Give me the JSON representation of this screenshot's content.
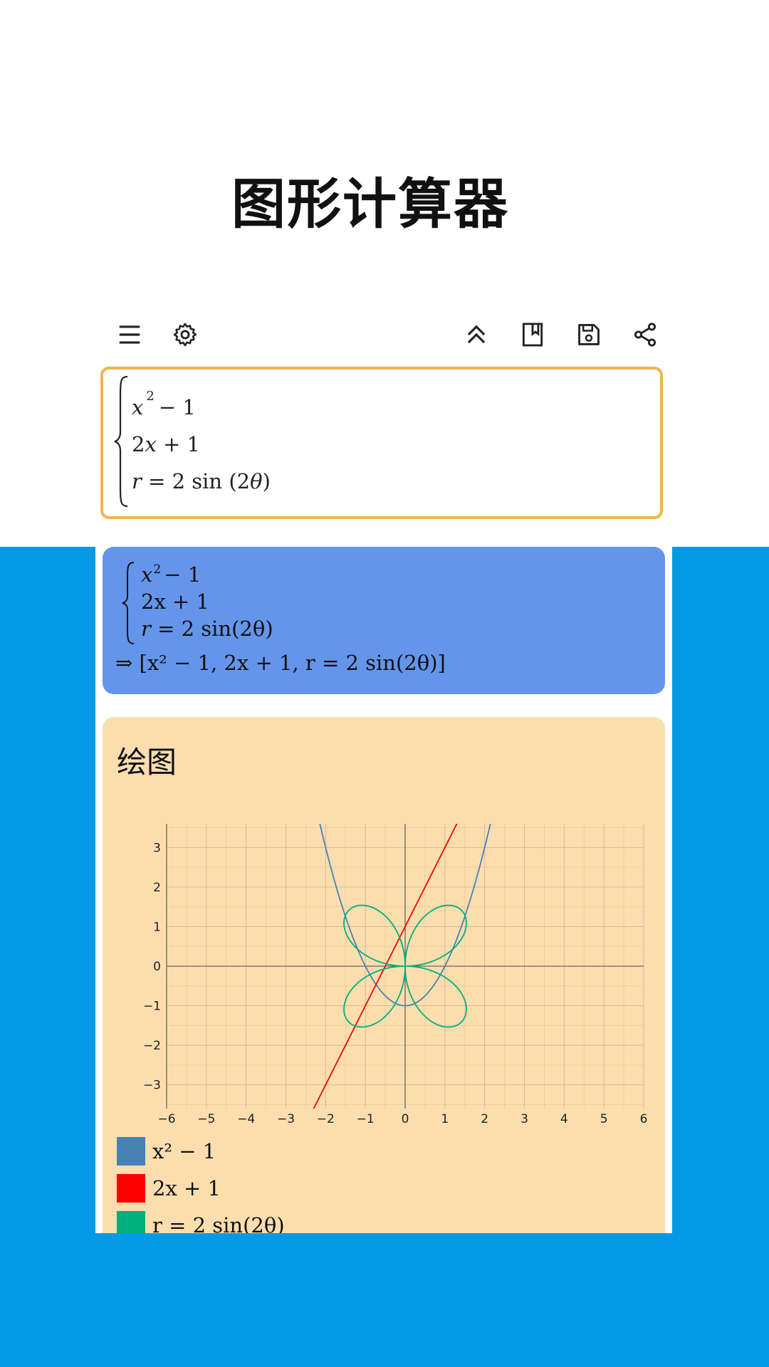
{
  "promo": {
    "title": "图形计算器"
  },
  "toolbar": {
    "icons": [
      "menu-icon",
      "gear-icon",
      "collapse-icon",
      "bookmark-icon",
      "save-icon",
      "share-icon"
    ]
  },
  "input": {
    "lines": [
      {
        "var": "x",
        "sup": "2",
        "rest": "− 1"
      },
      {
        "coef": "2",
        "var": "x",
        "rest": "+ 1"
      },
      {
        "lhs": "r",
        "rest": "= 2 sin (2",
        "theta": "θ",
        "close": ")"
      }
    ]
  },
  "result": {
    "line1_var": "x",
    "line1_sup": "2",
    "line1_rest": "− 1",
    "line2": "2x + 1",
    "line3_lhs": "r",
    "line3_rest": "= 2 sin(2θ)",
    "final": "⇒ [x² − 1, 2x + 1, r = 2 sin(2θ)]"
  },
  "plot": {
    "title": "绘图",
    "legend": [
      {
        "label": "x² − 1",
        "color": "#4682b4"
      },
      {
        "label": "2x + 1",
        "color": "#ff0000"
      },
      {
        "label": "r = 2 sin(2θ)",
        "color": "#00b07a"
      }
    ]
  },
  "chart_data": {
    "type": "line",
    "xlim": [
      -6,
      6
    ],
    "ylim": [
      -3.6,
      3.6
    ],
    "xticks": [
      -6,
      -5,
      -4,
      -3,
      -2,
      -1,
      0,
      1,
      2,
      3,
      4,
      5,
      6
    ],
    "yticks": [
      -3,
      -2,
      -1,
      0,
      1,
      2,
      3
    ],
    "grid": true,
    "series": [
      {
        "name": "x² − 1",
        "kind": "function",
        "expr": "x^2 - 1",
        "color": "#4682b4"
      },
      {
        "name": "2x + 1",
        "kind": "function",
        "expr": "2x + 1",
        "color": "#ff0000"
      },
      {
        "name": "r = 2 sin(2θ)",
        "kind": "polar",
        "expr": "2 sin(2θ)",
        "color": "#00b07a"
      }
    ]
  },
  "colors": {
    "accent_border": "#f4b34d",
    "result_bg": "#6495ea",
    "plot_bg": "#fcdeae",
    "page_bg": "#039be5"
  }
}
